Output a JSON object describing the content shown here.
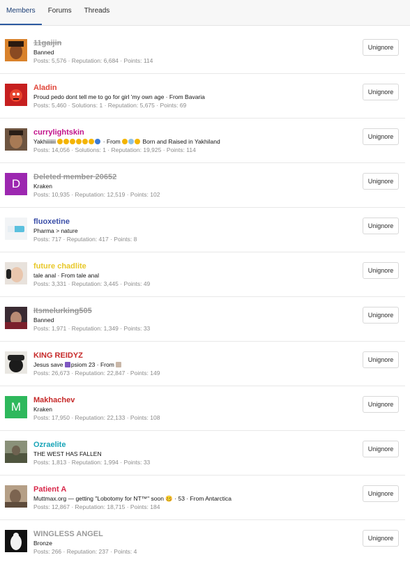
{
  "tabs": [
    {
      "label": "Members",
      "active": true
    },
    {
      "label": "Forums",
      "active": false
    },
    {
      "label": "Threads",
      "active": false
    }
  ],
  "button_label": "Unignore",
  "members": [
    {
      "name": "11gaijin",
      "name_color": "#9a9a9a",
      "strike": true,
      "title": "Banned",
      "stats": "Posts: 5,576 · Reputation: 6,684 · Points: 114",
      "avatar": "photo-orange"
    },
    {
      "name": "Aladin",
      "name_color": "#e0463a",
      "strike": false,
      "title": "Proud pedo dont tell me to go for girl 'my own age · From Bavaria",
      "stats": "Posts: 5,460 · Solutions: 1 · Reputation: 5,675 · Points: 69",
      "avatar": "photo-red"
    },
    {
      "name": "currylightskin",
      "name_color": "#c1118a",
      "strike": false,
      "title_prefix": "Yakhiiiiiii",
      "title_emoji_count": 7,
      "title_suffix": " · From",
      "title_suffix2": "Born and Raised in Yakhiland",
      "stats": "Posts: 14,056 · Solutions: 1 · Reputation: 19,925 · Points: 114",
      "avatar": "photo-brown"
    },
    {
      "name": "Deleted member 20652",
      "name_color": "#9a9a9a",
      "strike": true,
      "title": "Kraken",
      "stats": "Posts: 10,935 · Reputation: 12,519 · Points: 102",
      "avatar": "letter",
      "avatar_letter": "D",
      "avatar_bg": "#9c27b0"
    },
    {
      "name": "fluoxetine",
      "name_color": "#3b4fa8",
      "strike": false,
      "title": "Pharma > nature",
      "stats": "Posts: 717 · Reputation: 417 · Points: 8",
      "avatar": "photo-pill"
    },
    {
      "name": "future chadlite",
      "name_color": "#e8c82a",
      "strike": false,
      "title": "tale anal · From tale anal",
      "stats": "Posts: 3,331 · Reputation: 3,445 · Points: 49",
      "avatar": "photo-pale"
    },
    {
      "name": "Itsmelurking505",
      "name_color": "#9a9a9a",
      "strike": true,
      "title": "Banned",
      "stats": "Posts: 1,971 · Reputation: 1,349 · Points: 33",
      "avatar": "photo-dark"
    },
    {
      "name": "KING REIDYZ",
      "name_color": "#c62828",
      "strike": false,
      "title_prefix": "Jesus save",
      "title_mid": "psiom 23 · From",
      "stats": "Posts: 26,673 · Reputation: 22,847 · Points: 149",
      "avatar": "photo-hat"
    },
    {
      "name": "Makhachev",
      "name_color": "#c62828",
      "strike": false,
      "title": "Kraken",
      "stats": "Posts: 17,950 · Reputation: 22,133 · Points: 108",
      "avatar": "letter",
      "avatar_letter": "M",
      "avatar_bg": "#2eb85c"
    },
    {
      "name": "Ozraelite",
      "name_color": "#1aa5b8",
      "strike": false,
      "title": "THE WEST HAS FALLEN",
      "stats": "Posts: 1,813 · Reputation: 1,994 · Points: 33",
      "avatar": "photo-soldier"
    },
    {
      "name": "Patient A",
      "name_color": "#d8284a",
      "strike": false,
      "title": "Muttmax.org — getting \"Lobotomy for NT™\" soon 🥴 · 53 · From Antarctica",
      "stats": "Posts: 12,867 · Reputation: 18,715 · Points: 184",
      "avatar": "photo-sepia"
    },
    {
      "name": "WINGLESS ANGEL",
      "name_color": "#9a9a9a",
      "strike": false,
      "title": "Bronze",
      "stats": "Posts: 266 · Reputation: 237 · Points: 4",
      "avatar": "photo-statue"
    }
  ]
}
